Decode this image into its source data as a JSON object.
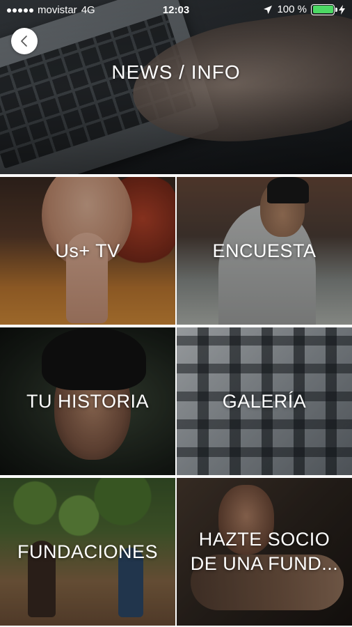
{
  "status_bar": {
    "carrier": "movistar",
    "network": "4G",
    "time": "12:03",
    "battery": "100 %",
    "battery_color": "#4cd964"
  },
  "header": {
    "back_icon": "chevron-left-icon",
    "title": "NEWS / INFO"
  },
  "tiles": [
    {
      "label": "Us+ TV"
    },
    {
      "label": "ENCUESTA"
    },
    {
      "label": "TU HISTORIA"
    },
    {
      "label": "GALERÍA"
    },
    {
      "label": "FUNDACIONES"
    },
    {
      "label": "HAZTE SOCIO DE UNA FUND..."
    }
  ]
}
